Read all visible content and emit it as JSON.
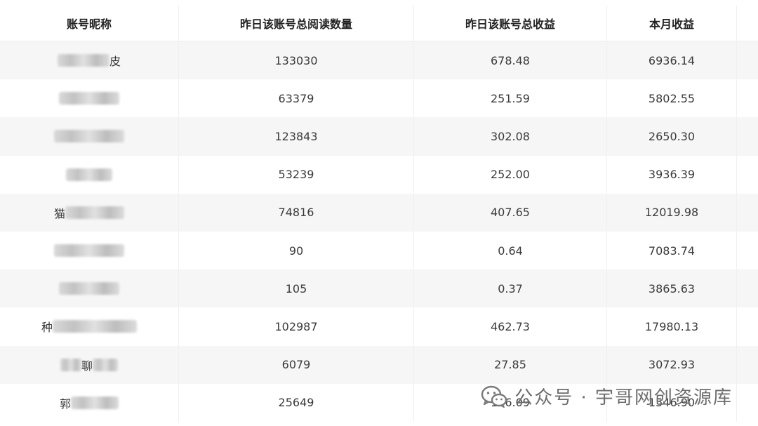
{
  "table": {
    "headers": [
      "账号昵称",
      "昨日该账号总阅读数量",
      "昨日该账号总收益",
      "本月收益"
    ],
    "rows": [
      {
        "name_char": "皮",
        "reads": "133030",
        "yesterday": "678.48",
        "month": "6936.14"
      },
      {
        "name_char": "",
        "reads": "63379",
        "yesterday": "251.59",
        "month": "5802.55"
      },
      {
        "name_char": "",
        "reads": "123843",
        "yesterday": "302.08",
        "month": "2650.30"
      },
      {
        "name_char": "",
        "reads": "53239",
        "yesterday": "252.00",
        "month": "3936.39"
      },
      {
        "name_char": "猫",
        "reads": "74816",
        "yesterday": "407.65",
        "month": "12019.98"
      },
      {
        "name_char": "",
        "reads": "90",
        "yesterday": "0.64",
        "month": "7083.74"
      },
      {
        "name_char": "",
        "reads": "105",
        "yesterday": "0.37",
        "month": "3865.63"
      },
      {
        "name_char": "种",
        "reads": "102987",
        "yesterday": "462.73",
        "month": "17980.13"
      },
      {
        "name_char": "聊",
        "reads": "6079",
        "yesterday": "27.85",
        "month": "3072.93"
      },
      {
        "name_char": "郭",
        "reads": "25649",
        "yesterday": "146.09",
        "month": "1546.90"
      }
    ]
  },
  "watermark": {
    "text": "公众号 · 宇哥网创资源库",
    "icon": "wechat-icon"
  }
}
